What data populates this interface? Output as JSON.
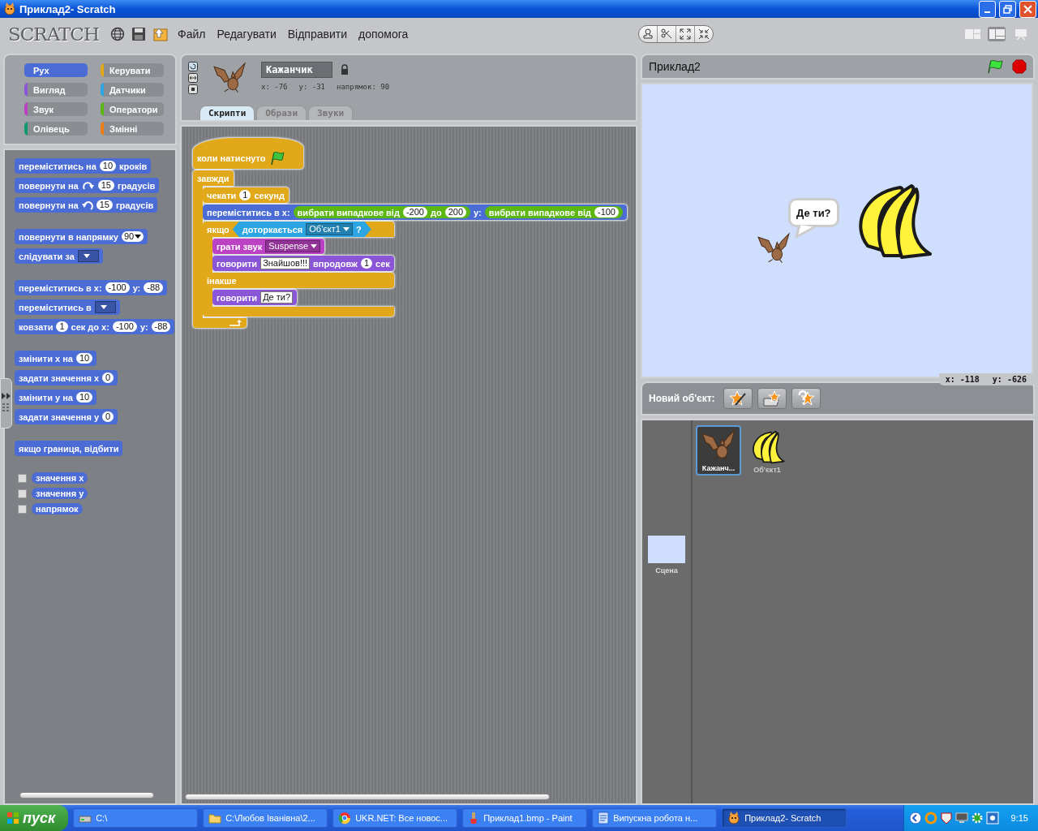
{
  "window": {
    "title": "Приклад2- Scratch"
  },
  "menu_bar": {
    "logo": "SCRATCH",
    "menus": [
      "Файл",
      "Редагувати",
      "Відправити",
      "допомога"
    ],
    "view_modes": [
      {
        "kind": "small_stage",
        "selected": false
      },
      {
        "kind": "normal",
        "selected": true
      },
      {
        "kind": "presentation",
        "selected": false
      }
    ]
  },
  "palette": {
    "categories": [
      {
        "label": "Рух",
        "color": "#4a6cd4",
        "selected": true
      },
      {
        "label": "Керувати",
        "color": "#e1a91a",
        "selected": false
      },
      {
        "label": "Вигляд",
        "color": "#8a55d7",
        "selected": false
      },
      {
        "label": "Датчики",
        "color": "#2ca5e2",
        "selected": false
      },
      {
        "label": "Звук",
        "color": "#bb42c3",
        "selected": false
      },
      {
        "label": "Оператори",
        "color": "#5cb712",
        "selected": false
      },
      {
        "label": "Олівець",
        "color": "#0e9a6c",
        "selected": false
      },
      {
        "label": "Змінні",
        "color": "#ee7d16",
        "selected": false
      }
    ],
    "groups": [
      [
        {
          "kind": "stack",
          "color": "#4a6cd4",
          "parts": [
            {
              "kind": "label",
              "text": "переміститись на"
            },
            {
              "kind": "num",
              "text": "10"
            },
            {
              "kind": "label",
              "text": "кроків"
            }
          ]
        },
        {
          "kind": "stack",
          "color": "#4a6cd4",
          "parts": [
            {
              "kind": "label",
              "text": "повернути на"
            },
            {
              "kind": "turn_cw"
            },
            {
              "kind": "num",
              "text": "15"
            },
            {
              "kind": "label",
              "text": "градусів"
            }
          ]
        },
        {
          "kind": "stack",
          "color": "#4a6cd4",
          "parts": [
            {
              "kind": "label",
              "text": "повернути на"
            },
            {
              "kind": "turn_ccw"
            },
            {
              "kind": "num",
              "text": "15"
            },
            {
              "kind": "label",
              "text": "градусів"
            }
          ]
        }
      ],
      [
        {
          "kind": "stack",
          "color": "#4a6cd4",
          "parts": [
            {
              "kind": "label",
              "text": "повернути в напрямку"
            },
            {
              "kind": "num_menu",
              "text": "90"
            }
          ]
        },
        {
          "kind": "stack",
          "color": "#4a6cd4",
          "parts": [
            {
              "kind": "label",
              "text": "слідувати за"
            },
            {
              "kind": "empty_menu"
            }
          ]
        }
      ],
      [
        {
          "kind": "stack",
          "color": "#4a6cd4",
          "parts": [
            {
              "kind": "label",
              "text": "переміститись в х:"
            },
            {
              "kind": "num",
              "text": "-100"
            },
            {
              "kind": "label",
              "text": "у:"
            },
            {
              "kind": "num",
              "text": "-88"
            }
          ]
        },
        {
          "kind": "stack",
          "color": "#4a6cd4",
          "parts": [
            {
              "kind": "label",
              "text": "переміститись в"
            },
            {
              "kind": "empty_menu"
            }
          ]
        },
        {
          "kind": "stack",
          "color": "#4a6cd4",
          "parts": [
            {
              "kind": "label",
              "text": "ковзати"
            },
            {
              "kind": "num",
              "text": "1"
            },
            {
              "kind": "label",
              "text": "сек до х:"
            },
            {
              "kind": "num",
              "text": "-100"
            },
            {
              "kind": "label",
              "text": "у:"
            },
            {
              "kind": "num",
              "text": "-88"
            }
          ]
        }
      ],
      [
        {
          "kind": "stack",
          "color": "#4a6cd4",
          "parts": [
            {
              "kind": "label",
              "text": "змінити х на"
            },
            {
              "kind": "num",
              "text": "10"
            }
          ]
        },
        {
          "kind": "stack",
          "color": "#4a6cd4",
          "parts": [
            {
              "kind": "label",
              "text": "задати значення х"
            },
            {
              "kind": "num",
              "text": "0"
            }
          ]
        },
        {
          "kind": "stack",
          "color": "#4a6cd4",
          "parts": [
            {
              "kind": "label",
              "text": "змінити у на"
            },
            {
              "kind": "num",
              "text": "10"
            }
          ]
        },
        {
          "kind": "stack",
          "color": "#4a6cd4",
          "parts": [
            {
              "kind": "label",
              "text": "задати значення у"
            },
            {
              "kind": "num",
              "text": "0"
            }
          ]
        }
      ],
      [
        {
          "kind": "stack",
          "color": "#4a6cd4",
          "parts": [
            {
              "kind": "label",
              "text": "якщо границя, відбити"
            }
          ]
        }
      ],
      [
        {
          "kind": "reporter",
          "color": "#4a6cd4",
          "checked": false,
          "parts": [
            {
              "kind": "label",
              "text": "значення х"
            }
          ]
        },
        {
          "kind": "reporter",
          "color": "#4a6cd4",
          "checked": false,
          "parts": [
            {
              "kind": "label",
              "text": "значення у"
            }
          ]
        },
        {
          "kind": "reporter",
          "color": "#4a6cd4",
          "checked": false,
          "parts": [
            {
              "kind": "label",
              "text": "напрямок"
            }
          ]
        }
      ]
    ]
  },
  "sprite_info": {
    "name": "Кажанчик",
    "x": "x: -76",
    "y": "y: -31",
    "direction": "напрямок: 90",
    "tabs": [
      {
        "label": "Скрипти",
        "selected": true
      },
      {
        "label": "Образи",
        "selected": false
      },
      {
        "label": "Звуки",
        "selected": false
      }
    ]
  },
  "script": [
    {
      "kind": "hat",
      "color": "#e1a91a",
      "parts": [
        {
          "kind": "label",
          "text": "коли натиснуто"
        },
        {
          "kind": "flag"
        }
      ]
    },
    {
      "kind": "c",
      "color": "#e1a91a",
      "parts": [
        {
          "kind": "label",
          "text": "завжди"
        }
      ],
      "children": [
        {
          "kind": "stack",
          "color": "#e1a91a",
          "parts": [
            {
              "kind": "label",
              "text": "чекати"
            },
            {
              "kind": "num",
              "text": "1"
            },
            {
              "kind": "label",
              "text": "секунд"
            }
          ]
        },
        {
          "kind": "stack",
          "color": "#4a6cd4",
          "parts": [
            {
              "kind": "label",
              "text": "переміститись в х:"
            },
            {
              "kind": "reporter",
              "color": "#5cb712",
              "parts": [
                {
                  "kind": "label",
                  "text": "вибрати випадкове від"
                },
                {
                  "kind": "num",
                  "text": "-200"
                },
                {
                  "kind": "label",
                  "text": "до"
                },
                {
                  "kind": "num",
                  "text": "200"
                }
              ]
            },
            {
              "kind": "label",
              "text": "у:"
            },
            {
              "kind": "reporter",
              "color": "#5cb712",
              "parts": [
                {
                  "kind": "label",
                  "text": "вибрати випадкове від"
                },
                {
                  "kind": "num",
                  "text": "-100"
                }
              ]
            }
          ]
        },
        {
          "kind": "if_else",
          "color": "#e1a91a",
          "parts": [
            {
              "kind": "label",
              "text": "якщо"
            },
            {
              "kind": "boolean",
              "color": "#2ca5e2",
              "parts": [
                {
                  "kind": "label",
                  "text": "доторкається"
                },
                {
                  "kind": "menu",
                  "text": "Об'єкт1"
                },
                {
                  "kind": "label",
                  "text": "?"
                }
              ]
            }
          ],
          "children": [
            {
              "kind": "stack",
              "color": "#bb42c3",
              "parts": [
                {
                  "kind": "label",
                  "text": "грати звук"
                },
                {
                  "kind": "menu",
                  "text": "Suspense"
                }
              ]
            },
            {
              "kind": "stack",
              "color": "#8a55d7",
              "parts": [
                {
                  "kind": "label",
                  "text": "говорити"
                },
                {
                  "kind": "str",
                  "text": "Знайшов!!!"
                },
                {
                  "kind": "label",
                  "text": "впродовж"
                },
                {
                  "kind": "num",
                  "text": "1"
                },
                {
                  "kind": "label",
                  "text": "сек"
                }
              ]
            }
          ],
          "else_parts": [
            {
              "kind": "label",
              "text": "інакше"
            }
          ],
          "else_children": [
            {
              "kind": "stack",
              "color": "#8a55d7",
              "parts": [
                {
                  "kind": "label",
                  "text": "говорити"
                },
                {
                  "kind": "str",
                  "text": "Де ти?"
                }
              ]
            }
          ]
        }
      ]
    }
  ],
  "stage": {
    "title": "Приклад2",
    "speech": "Де ти?",
    "mouse_x": "x: -118",
    "mouse_y": "y: -626"
  },
  "sprites": {
    "new_label": "Новий об'єкт:",
    "items": [
      {
        "name": "Кажанч...",
        "kind": "bat",
        "selected": true
      },
      {
        "name": "Об'єкт1",
        "kind": "banana",
        "selected": false
      }
    ],
    "stage_label": "Сцена"
  },
  "taskbar": {
    "start": "пуск",
    "tasks": [
      {
        "label": "C:\\",
        "kind": "drive",
        "selected": false
      },
      {
        "label": "C:\\Любов Іванівна\\2...",
        "kind": "folder",
        "selected": false
      },
      {
        "label": "UKR.NET: Все новос...",
        "kind": "browser",
        "selected": false
      },
      {
        "label": "Приклад1.bmp - Paint",
        "kind": "paint",
        "selected": false
      },
      {
        "label": "Випускна робота н...",
        "kind": "document",
        "selected": false
      },
      {
        "label": "Приклад2- Scratch",
        "kind": "scratch",
        "selected": true
      }
    ],
    "clock": "9:15"
  }
}
